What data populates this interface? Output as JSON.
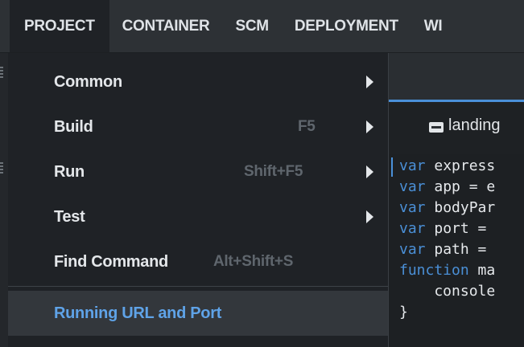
{
  "menubar": {
    "items": [
      "PROJECT",
      "CONTAINER",
      "SCM",
      "DEPLOYMENT",
      "WI"
    ]
  },
  "dropdown": {
    "items": [
      {
        "label": "Common",
        "shortcut": "",
        "submenu": true
      },
      {
        "label": "Build",
        "shortcut": "F5",
        "submenu": true
      },
      {
        "label": "Run",
        "shortcut": "Shift+F5",
        "submenu": true
      },
      {
        "label": "Test",
        "shortcut": "",
        "submenu": true
      },
      {
        "label": "Find Command",
        "shortcut": "Alt+Shift+S",
        "submenu": false
      },
      {
        "label": "Running URL and Port",
        "shortcut": "",
        "submenu": false,
        "highlighted": true
      }
    ]
  },
  "editor": {
    "tab_label": "landing",
    "code_lines": [
      {
        "keyword": "var",
        "rest": " express"
      },
      {
        "keyword": "var",
        "rest": " app = e"
      },
      {
        "keyword": "var",
        "rest": " bodyPar"
      },
      {
        "keyword": "var",
        "rest": " port = "
      },
      {
        "keyword": "var",
        "rest": " path = "
      },
      {
        "keyword": "function",
        "rest": " ma"
      },
      {
        "keyword": "",
        "rest": "    console"
      },
      {
        "keyword": "",
        "rest": "}"
      }
    ]
  },
  "colors": {
    "accent": "#4a90d9",
    "highlight_text": "#5fa3e8",
    "menu_bg": "#1f2226"
  },
  "icons": {
    "submenu": "chevron-right-icon",
    "tab": "file-icon"
  }
}
